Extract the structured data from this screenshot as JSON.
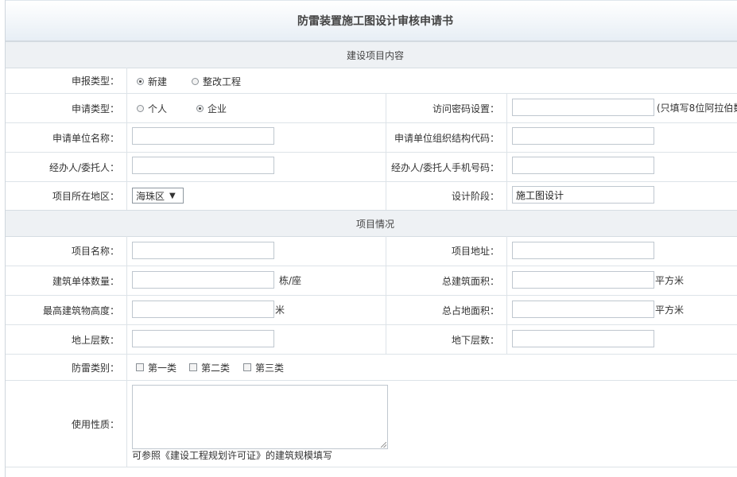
{
  "form": {
    "title": "防雷装置施工图设计审核申请书",
    "section_project_content": "建设项目内容",
    "section_project_info": "项目情况"
  },
  "fields": {
    "report_type": {
      "label": "申报类型：",
      "options": [
        "新建",
        "整改工程"
      ],
      "selected": "新建"
    },
    "apply_type": {
      "label": "申请类型：",
      "options": [
        "个人",
        "企业"
      ],
      "selected": "企业"
    },
    "password": {
      "label": "访问密码设置：",
      "value": "",
      "hint": "(只填写8位阿拉伯数"
    },
    "unit_name": {
      "label": "申请单位名称：",
      "value": ""
    },
    "org_code": {
      "label": "申请单位组织结构代码：",
      "value": ""
    },
    "agent": {
      "label": "经办人/委托人：",
      "value": ""
    },
    "agent_phone": {
      "label": "经办人/委托人手机号码：",
      "value": ""
    },
    "region": {
      "label": "项目所在地区：",
      "value": "海珠区",
      "arrow": "▼"
    },
    "design_stage": {
      "label": "设计阶段：",
      "value": "施工图设计"
    },
    "project_name": {
      "label": "项目名称：",
      "value": ""
    },
    "project_address": {
      "label": "项目地址：",
      "value": ""
    },
    "building_count": {
      "label": "建筑单体数量：",
      "value": "",
      "unit": "栋/座"
    },
    "total_area": {
      "label": "总建筑面积：",
      "value": "",
      "unit": "平方米"
    },
    "max_height": {
      "label": "最高建筑物高度：",
      "value": "",
      "unit": "米"
    },
    "land_area": {
      "label": "总占地面积：",
      "value": "",
      "unit": "平方米"
    },
    "floors_above": {
      "label": "地上层数：",
      "value": ""
    },
    "floors_below": {
      "label": "地下层数：",
      "value": ""
    },
    "lightning_class": {
      "label": "防雷类别：",
      "options": [
        "第一类",
        "第二类",
        "第三类"
      ]
    },
    "usage": {
      "label": "使用性质：",
      "value": "",
      "hint": "可参照《建设工程规划许可证》的建筑规模填写"
    }
  }
}
